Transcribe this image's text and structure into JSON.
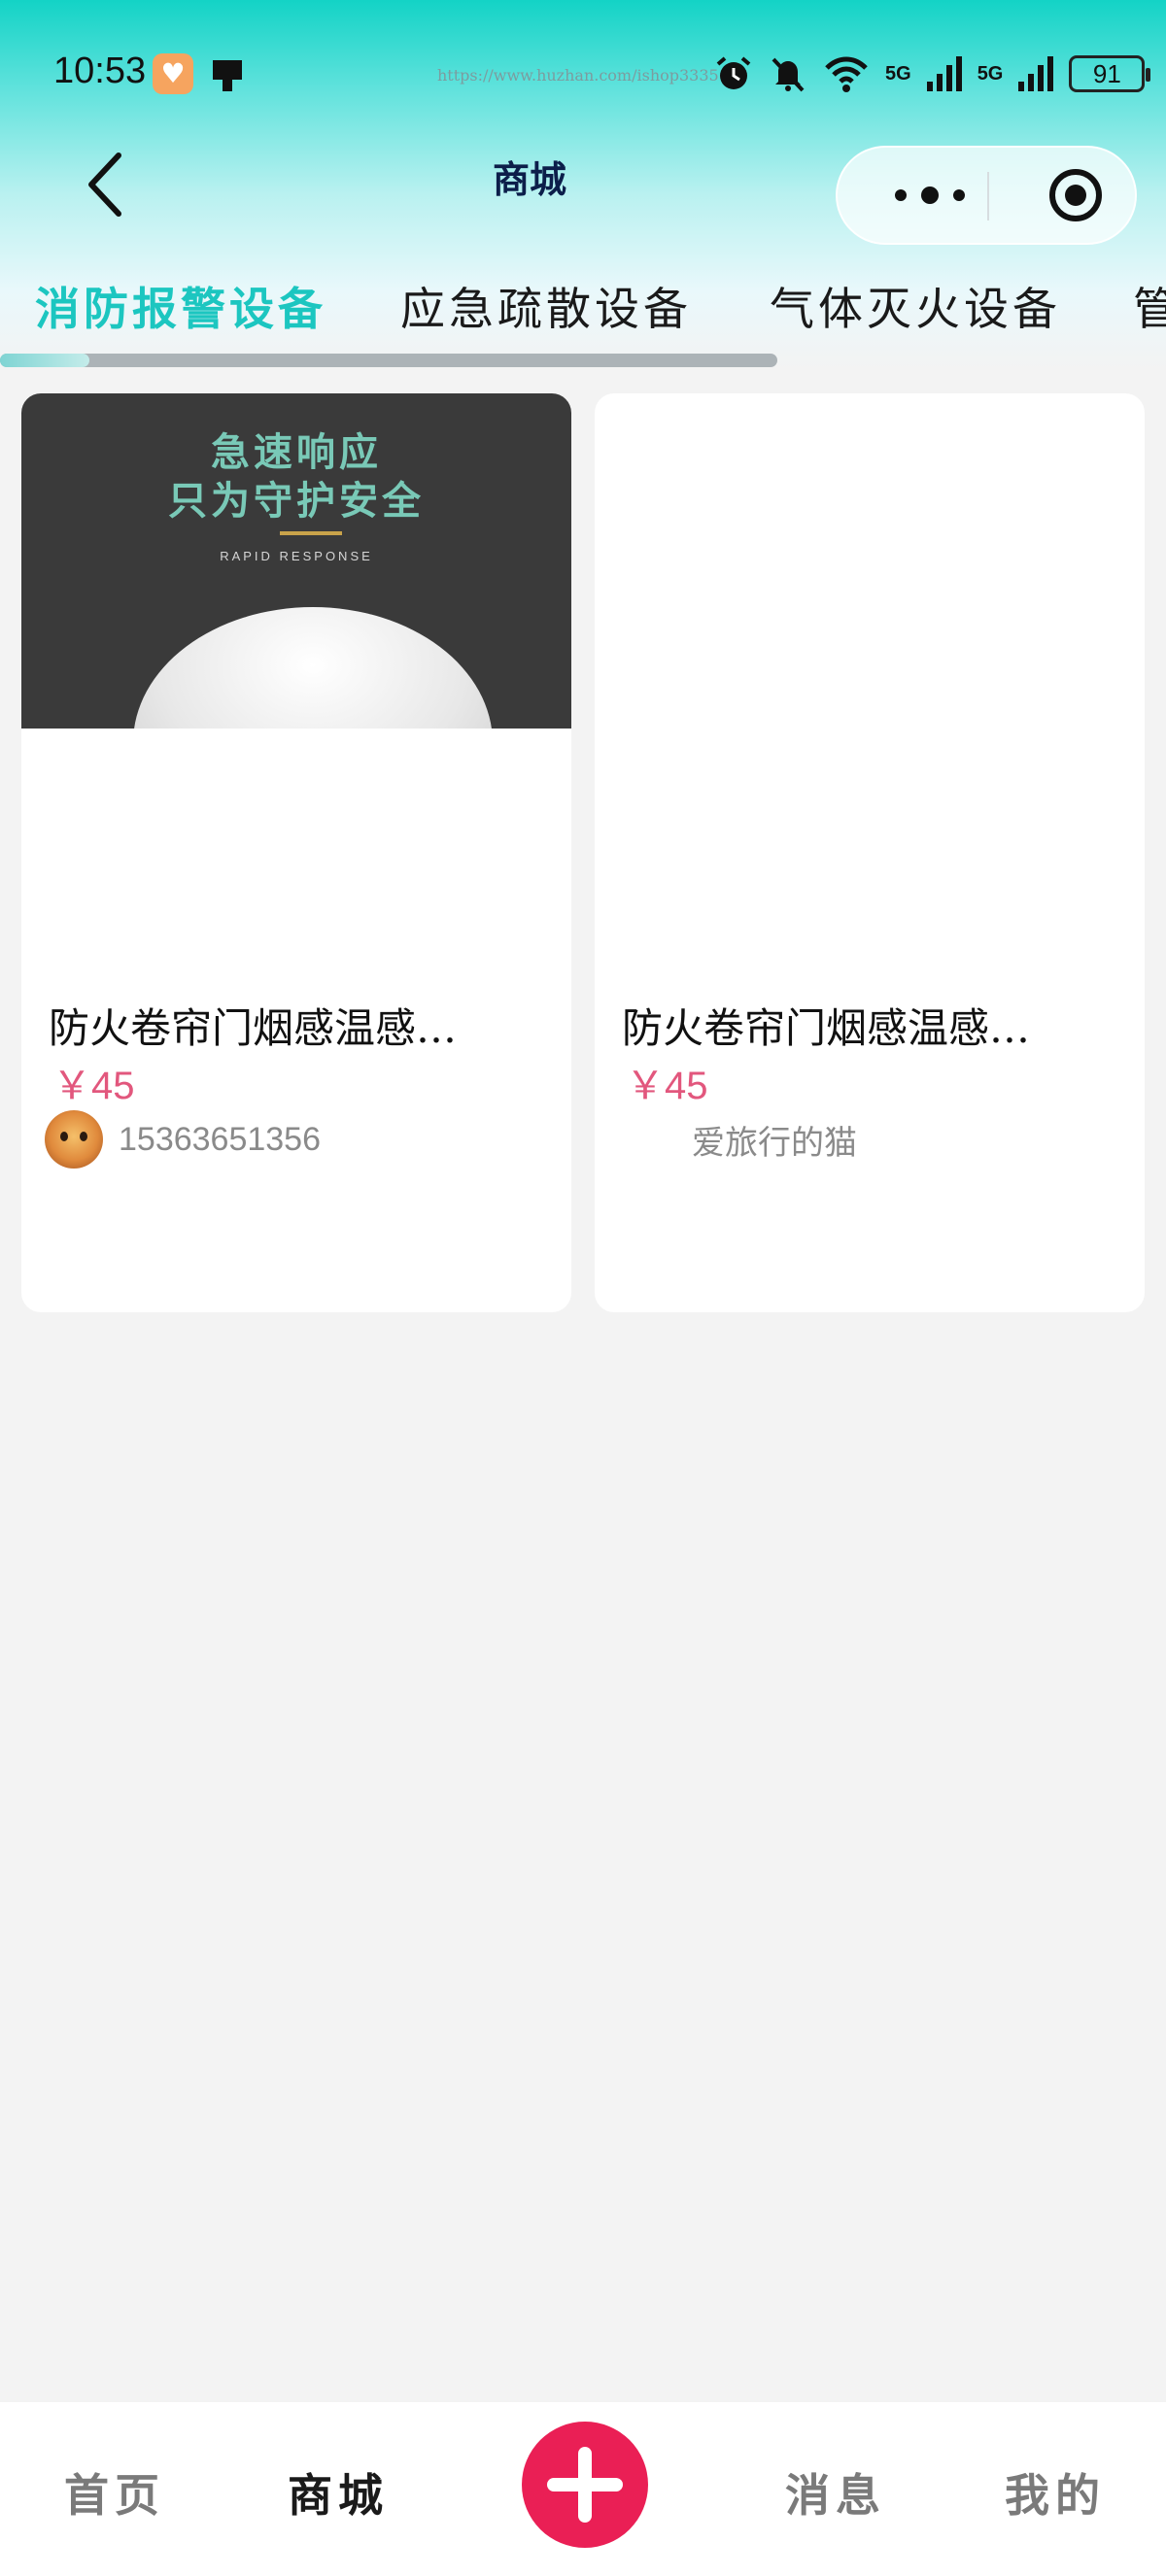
{
  "status_bar": {
    "time": "10:53",
    "url_watermark": "https://www.huzhan.com/ishop3335",
    "network_1": "5G",
    "network_2": "5G",
    "battery": "91"
  },
  "nav": {
    "title": "商城"
  },
  "category_tabs": [
    {
      "label": "消防报警设备",
      "active": true
    },
    {
      "label": "应急疏散设备",
      "active": false
    },
    {
      "label": "气体灭火设备",
      "active": false
    },
    {
      "label": "管",
      "active": false
    }
  ],
  "products": [
    {
      "image_text_1": "急速响应",
      "image_text_2": "只为守护安全",
      "image_text_3": "RAPID RESPONSE",
      "title": "防火卷帘门烟感温感…",
      "price": "￥45",
      "seller": "15363651356"
    },
    {
      "title": "防火卷帘门烟感温感…",
      "price": "￥45",
      "seller": "爱旅行的猫"
    }
  ],
  "bottom_tabs": {
    "home": "首页",
    "mall": "商城",
    "messages": "消息",
    "mine": "我的"
  },
  "colors": {
    "accent": "#1cc6c0",
    "price": "#e2577d",
    "plus_button": "#ea1f55"
  }
}
